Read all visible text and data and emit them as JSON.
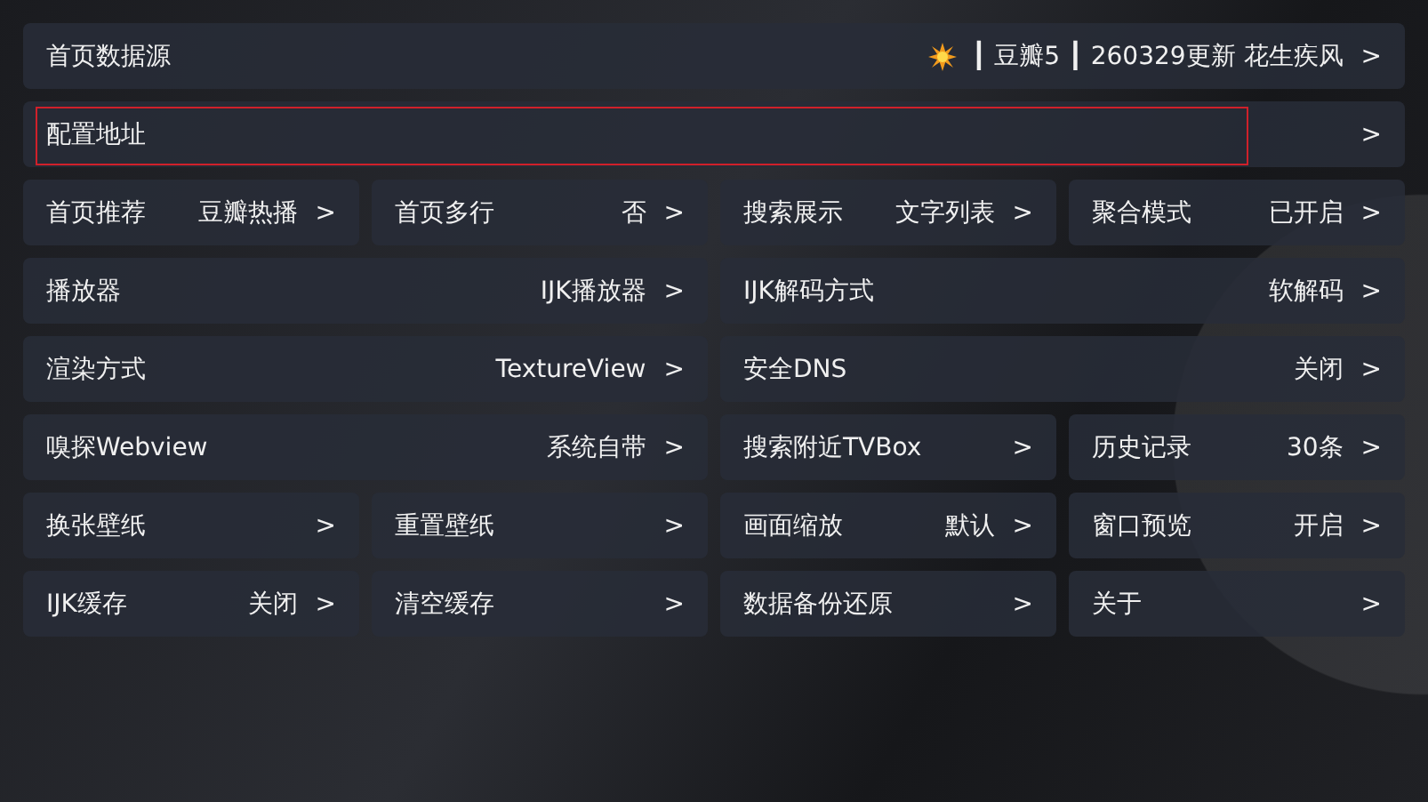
{
  "header_rows": [
    {
      "label": "首页数据源",
      "value": "┃ 豆瓣5 ┃ 260329更新 花生疾风",
      "kind": "source",
      "chevron": ">",
      "focused": false
    },
    {
      "label": "配置地址",
      "kind": "plain",
      "chevron": ">",
      "focused": true
    }
  ],
  "settings": [
    {
      "label": "首页推荐",
      "value": "豆瓣热播",
      "chevron": ">",
      "wide": false
    },
    {
      "label": "首页多行",
      "value": "否",
      "chevron": ">",
      "wide": false
    },
    {
      "label": "搜索展示",
      "value": "文字列表",
      "chevron": ">",
      "wide": false
    },
    {
      "label": "聚合模式",
      "value": "已开启",
      "chevron": ">",
      "wide": false
    },
    {
      "label": "播放器",
      "value": "IJK播放器",
      "chevron": ">",
      "wide": true
    },
    {
      "label": "IJK解码方式",
      "value": "软解码",
      "chevron": ">",
      "wide": true
    },
    {
      "label": "渲染方式",
      "value": "TextureView",
      "chevron": ">",
      "wide": true
    },
    {
      "label": "安全DNS",
      "value": "关闭",
      "chevron": ">",
      "wide": true
    },
    {
      "label": "嗅探Webview",
      "value": "系统自带",
      "chevron": ">",
      "wide": true
    },
    {
      "label": "搜索附近TVBox",
      "chevron": ">",
      "wide": false
    },
    {
      "label": "历史记录",
      "value": "30条",
      "chevron": ">",
      "wide": false
    },
    {
      "label": "换张壁纸",
      "chevron": ">",
      "wide": false
    },
    {
      "label": "重置壁纸",
      "chevron": ">",
      "wide": false
    },
    {
      "label": "画面缩放",
      "value": "默认",
      "chevron": ">",
      "wide": false
    },
    {
      "label": "窗口预览",
      "value": "开启",
      "chevron": ">",
      "wide": false
    },
    {
      "label": "IJK缓存",
      "value": "关闭",
      "chevron": ">",
      "wide": false
    },
    {
      "label": "清空缓存",
      "chevron": ">",
      "wide": false
    },
    {
      "label": "数据备份还原",
      "chevron": ">",
      "wide": false
    },
    {
      "label": "关于",
      "chevron": ">",
      "wide": false
    }
  ]
}
